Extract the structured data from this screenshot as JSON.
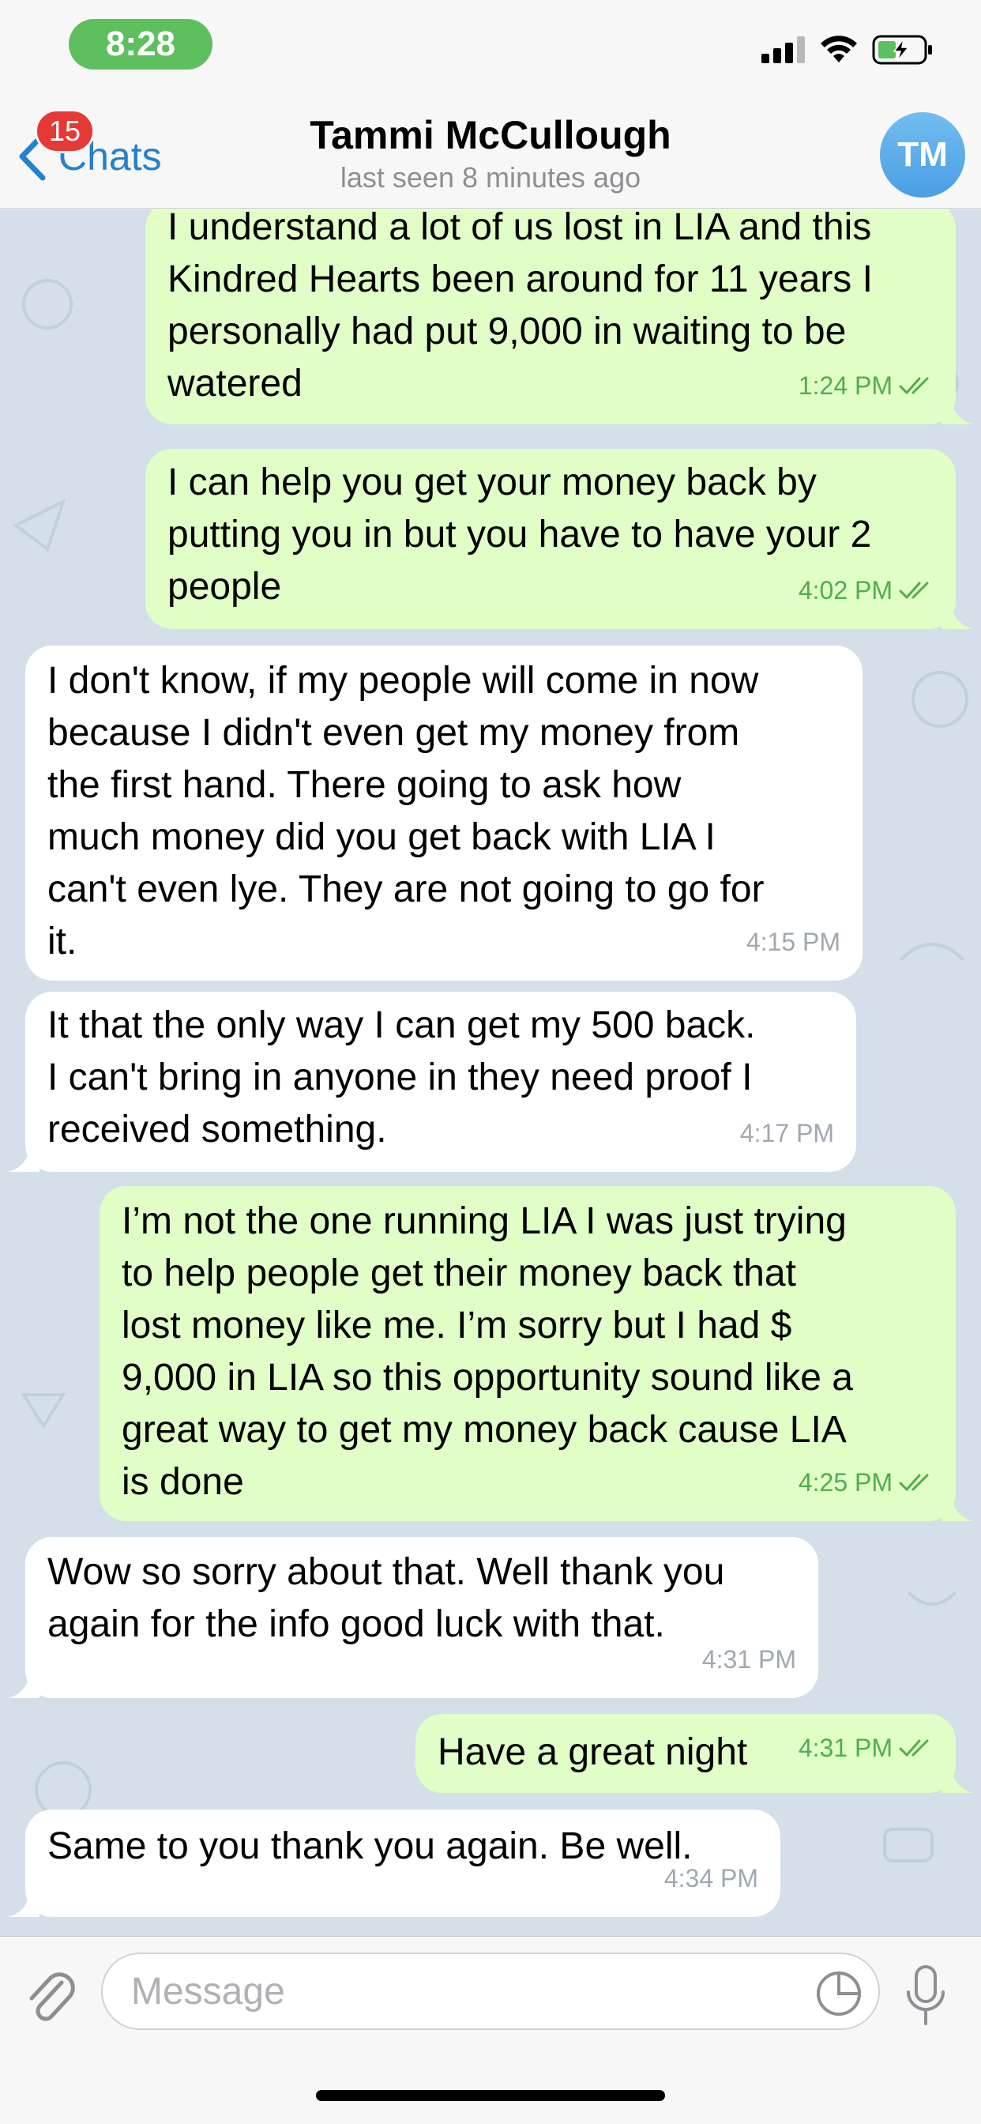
{
  "status_bar": {
    "time": "8:28",
    "time_color": "#5ebf5e"
  },
  "header": {
    "back_label": "Chats",
    "unread_badge": "15",
    "contact_name": "Tammi McCullough",
    "last_seen": "last seen 8 minutes ago",
    "avatar_initials": "TM"
  },
  "messages": [
    {
      "direction": "out",
      "text": "I understand a lot of us lost in LIA and this\nKindred Hearts been around for 11 years  I\npersonally had put 9,000 in waiting to be\nwatered",
      "time": "1:24 PM",
      "read": true
    },
    {
      "direction": "out",
      "text": "I can help you get your money back by\nputting you in but you have to have your 2\npeople",
      "time": "4:02 PM",
      "read": true
    },
    {
      "direction": "in",
      "text": "I don't know, if  my people will come in now\nbecause  I didn't even get my money from\nthe first  hand. There going to ask how\nmuch money did you get back  with LIA  I\ncan't even lye.  They are not going to go for\nit.",
      "time": "4:15 PM"
    },
    {
      "direction": "in",
      "text": "It  that the only way I can get my 500 back.\nI can't bring in anyone in they need proof  I\nreceived something.",
      "time": "4:17 PM"
    },
    {
      "direction": "out",
      "text": "I’m not the one running LIA  I was just trying\nto help people get their money back that\nlost money like me. I’m sorry but I had $\n9,000  in LIA so this opportunity sound like a\ngreat way to get my money back cause LIA\nis done",
      "time": "4:25 PM",
      "read": true
    },
    {
      "direction": "in",
      "text": "Wow so sorry about that.  Well thank you\nagain for the info good luck with  that.",
      "time": "4:31 PM"
    },
    {
      "direction": "out",
      "text": "Have a great night",
      "time": "4:31 PM",
      "read": true
    },
    {
      "direction": "in",
      "text": "Same to you  thank you again.  Be well.",
      "time": "4:34 PM"
    }
  ],
  "input": {
    "placeholder": "Message"
  },
  "colors": {
    "accent": "#2481cc",
    "outgoing_bubble": "#e1fec6",
    "incoming_bubble": "#ffffff",
    "chat_background": "#d5dfe9",
    "badge": "#e53935"
  }
}
